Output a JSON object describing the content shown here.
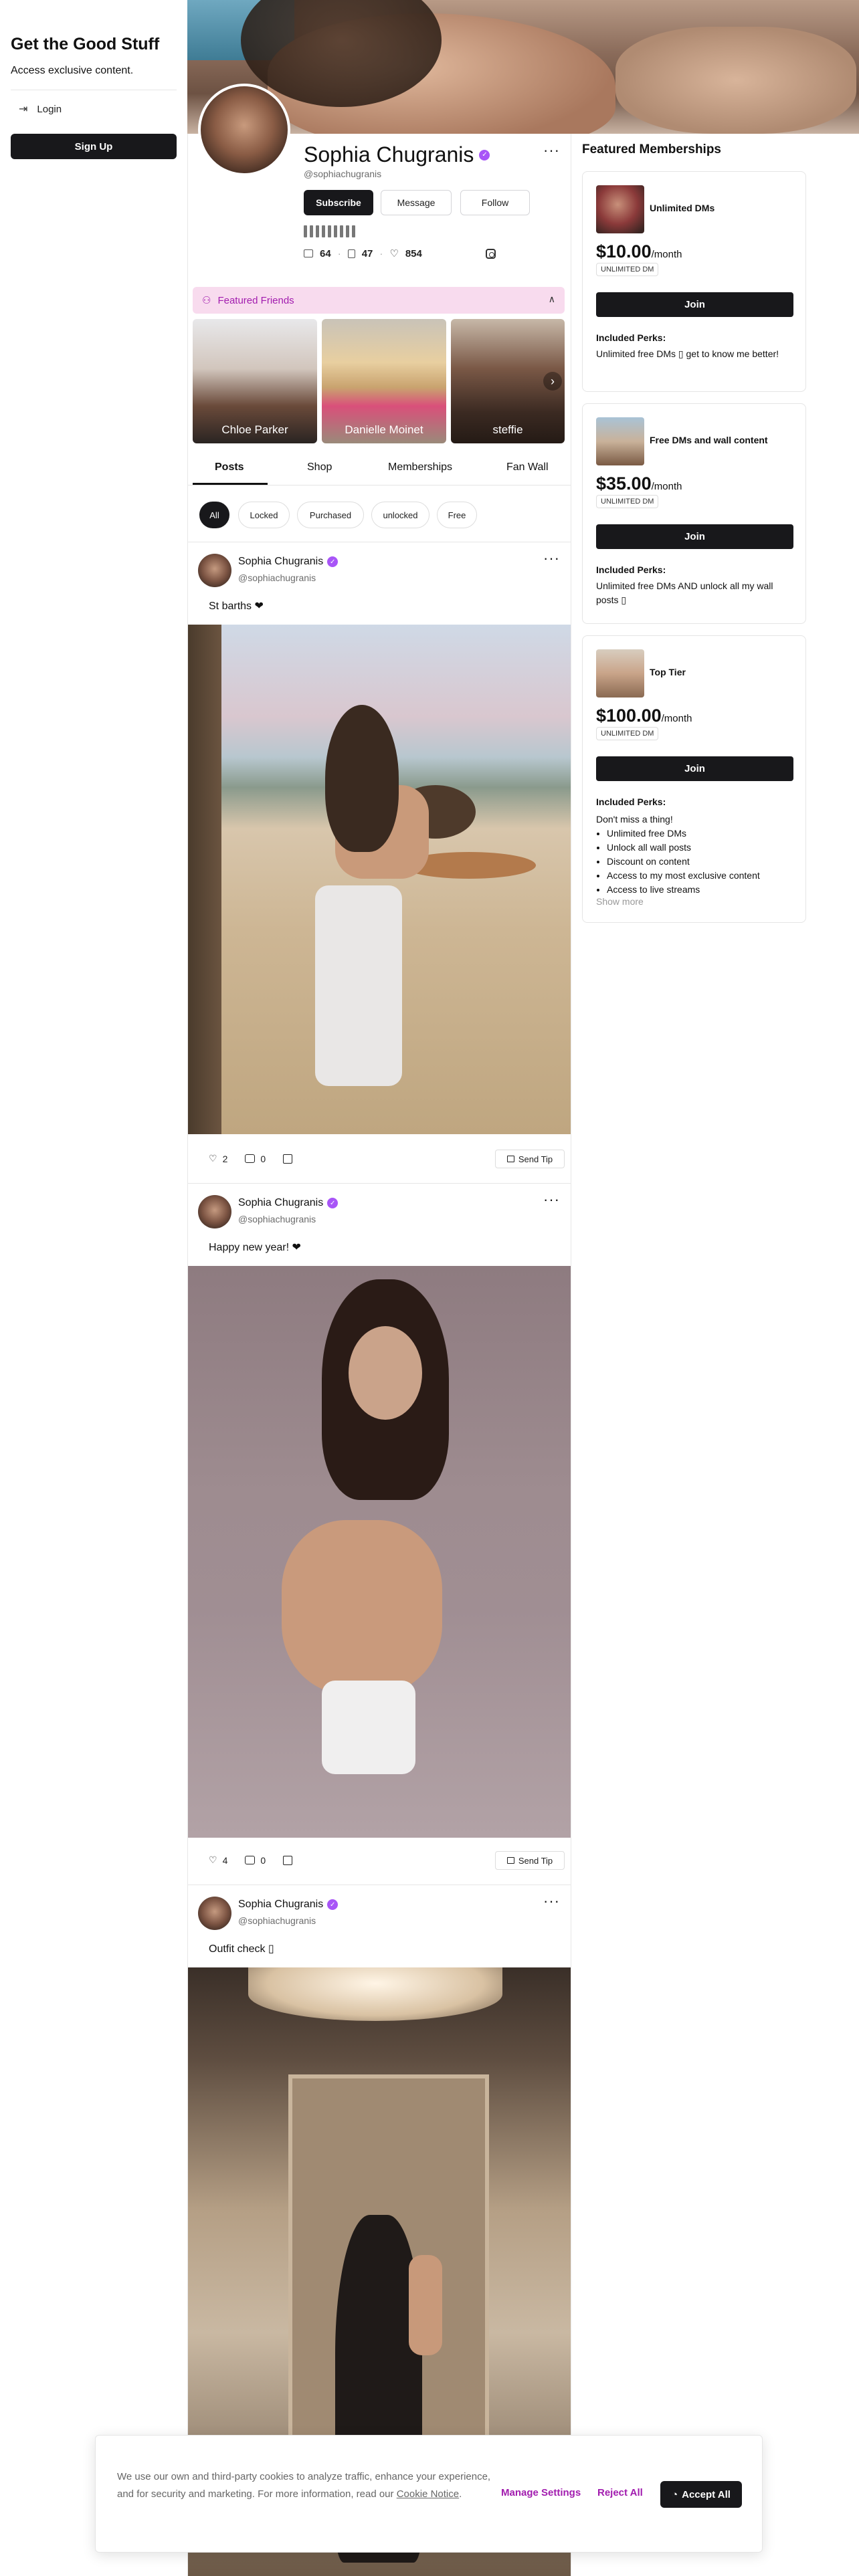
{
  "sidebar": {
    "brand_title": "Get the Good Stuff",
    "brand_subtitle": "Access exclusive content.",
    "login_label": "Login",
    "signup_label": "Sign Up"
  },
  "profile": {
    "name": "Sophia Chugranis",
    "handle": "@sophiachugranis",
    "more": "···",
    "subscribe_label": "Subscribe",
    "message_label": "Message",
    "follow_label": "Follow",
    "stats": {
      "media": "64",
      "posts": "47",
      "likes": "854"
    },
    "verified_color": "#a855f7"
  },
  "featured_friends": {
    "label": "Featured Friends",
    "friends": [
      "Chloe Parker",
      "Danielle Moinet",
      "steffie"
    ]
  },
  "tabs": [
    "Posts",
    "Shop",
    "Memberships",
    "Fan Wall"
  ],
  "filters": [
    "All",
    "Locked",
    "Purchased",
    "unlocked",
    "Free"
  ],
  "posts": [
    {
      "author": "Sophia Chugranis",
      "handle": "@sophiachugranis",
      "caption": "St barths ❤",
      "likes": "2",
      "comments": "0",
      "tip_label": "Send Tip"
    },
    {
      "author": "Sophia Chugranis",
      "handle": "@sophiachugranis",
      "caption": "Happy new year! ❤",
      "likes": "4",
      "comments": "0",
      "tip_label": "Send Tip"
    },
    {
      "author": "Sophia Chugranis",
      "handle": "@sophiachugranis",
      "caption": "Outfit check ▯"
    }
  ],
  "memberships": {
    "title": "Featured Memberships",
    "items": [
      {
        "name": "Unlimited DMs",
        "price": "$10.00",
        "period": "/month",
        "badge": "UNLIMITED DM",
        "join_label": "Join",
        "perks_title": "Included Perks:",
        "perks_text": "Unlimited free DMs ▯ get to know me better!"
      },
      {
        "name": "Free DMs and wall content",
        "price": "$35.00",
        "period": "/month",
        "badge": "UNLIMITED DM",
        "join_label": "Join",
        "perks_title": "Included Perks:",
        "perks_text": "Unlimited free DMs AND unlock all my wall posts ▯"
      },
      {
        "name": "Top Tier",
        "price": "$100.00",
        "period": "/month",
        "badge": "UNLIMITED DM",
        "join_label": "Join",
        "perks_title": "Included Perks:",
        "perks_intro": "Don't miss a thing!",
        "perks_list": [
          "Unlimited free DMs",
          "Unlock all wall posts",
          "Discount on content",
          "Access to my most exclusive content",
          "Access to live streams"
        ],
        "show_more": "Show more"
      }
    ]
  },
  "cookie": {
    "text": "We use our own and third-party cookies to analyze traffic, enhance your experience, and for security and marketing. For more information, read our",
    "notice_link": "Cookie Notice",
    "manage_label": "Manage Settings",
    "reject_label": "Reject All",
    "accept_label": "Accept All",
    "accent_color": "#a21caf"
  }
}
